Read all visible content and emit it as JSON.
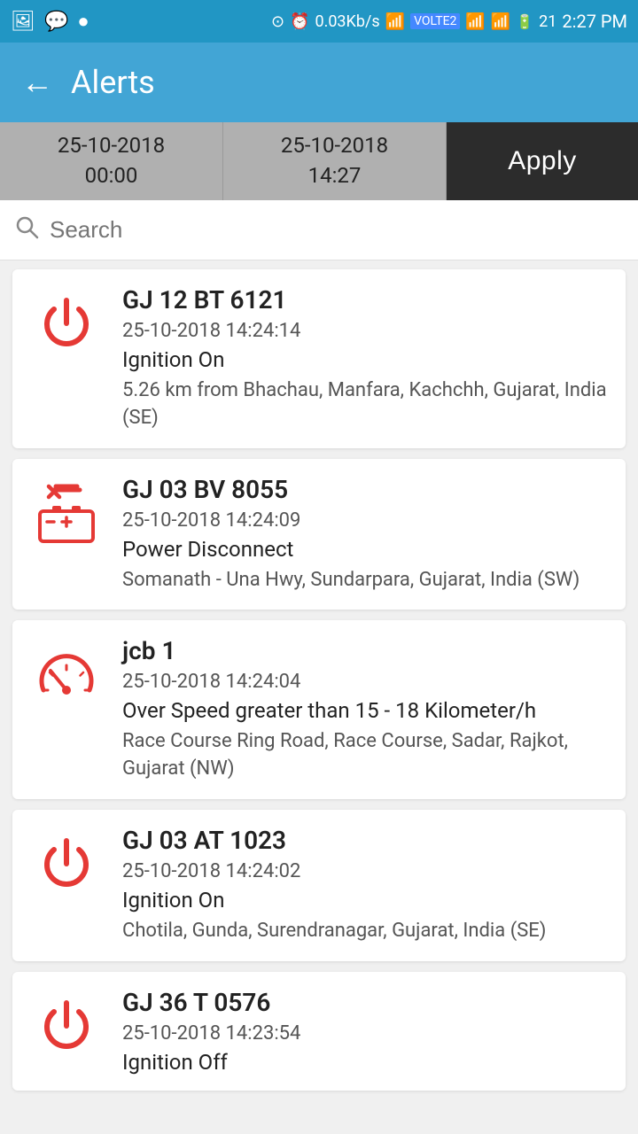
{
  "statusBar": {
    "network": "0.03Kb/s",
    "time": "2:27 PM",
    "battery": "21"
  },
  "appBar": {
    "title": "Alerts",
    "backLabel": "←"
  },
  "dateFilter": {
    "startDate": "25-10-2018",
    "startTime": "00:00",
    "endDate": "25-10-2018",
    "endTime": "14:27",
    "applyLabel": "Apply"
  },
  "search": {
    "placeholder": "Search"
  },
  "alerts": [
    {
      "id": 1,
      "vehicle": "GJ 12 BT 6121",
      "datetime": "25-10-2018 14:24:14",
      "type": "Ignition On",
      "location": "5.26 km from Bhachau, Manfara, Kachchh, Gujarat, India (SE)",
      "iconType": "power"
    },
    {
      "id": 2,
      "vehicle": "GJ 03 BV 8055",
      "datetime": "25-10-2018 14:24:09",
      "type": "Power Disconnect",
      "location": "Somanath - Una Hwy,  Sundarpara, Gujarat,  India (SW)",
      "iconType": "battery"
    },
    {
      "id": 3,
      "vehicle": "jcb 1",
      "datetime": "25-10-2018 14:24:04",
      "type": "Over Speed greater than 15 - 18 Kilometer/h",
      "location": "Race Course Ring Road, Race Course, Sadar, Rajkot, Gujarat (NW)",
      "iconType": "speed"
    },
    {
      "id": 4,
      "vehicle": "GJ 03 AT 1023",
      "datetime": "25-10-2018 14:24:02",
      "type": "Ignition On",
      "location": "Chotila, Gunda, Surendranagar, Gujarat, India (SE)",
      "iconType": "power"
    },
    {
      "id": 5,
      "vehicle": "GJ 36 T 0576",
      "datetime": "25-10-2018 14:23:54",
      "type": "Ignition Off",
      "location": "",
      "iconType": "power"
    }
  ]
}
